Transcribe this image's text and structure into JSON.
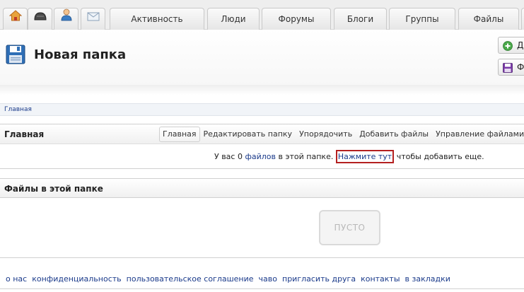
{
  "tabs": {
    "icon_tabs": [
      {
        "name": "home-icon"
      },
      {
        "name": "helmet-icon"
      },
      {
        "name": "user-icon"
      },
      {
        "name": "mail-icon"
      }
    ],
    "text_tabs": [
      "Активность",
      "Люди",
      "Форумы",
      "Блоги",
      "Группы",
      "Файлы"
    ]
  },
  "header": {
    "title": "Новая папка",
    "title_icon": "floppy-disk-icon",
    "buttons": [
      {
        "label": "Д",
        "icon": "add-circle-icon"
      },
      {
        "label": "Ф",
        "icon": "floppy-disk-icon"
      }
    ]
  },
  "breadcrumb": "Главная",
  "folder_section": {
    "title": "Главная",
    "tabs": [
      "Главная",
      "Редактировать папку",
      "Упорядочить",
      "Добавить файлы",
      "Управление файлами"
    ],
    "message": {
      "prefix": "У вас 0 ",
      "files_link": "файлов",
      "middle": " в этой папке. ",
      "click_link": "Нажмите тут",
      "suffix": " чтобы добавить еще."
    }
  },
  "files_section": {
    "title": "Файлы в этой папке",
    "empty_label": "ПУСТО"
  },
  "footer": {
    "links": [
      "о нас",
      "конфиденциальность",
      "пользовательское соглашение",
      "чаво",
      "пригласить друга",
      "контакты",
      "в закладки"
    ]
  },
  "colors": {
    "link": "#1a3a8a",
    "highlight_border": "#b42020",
    "title_icon_blue": "#2f6fb6"
  }
}
